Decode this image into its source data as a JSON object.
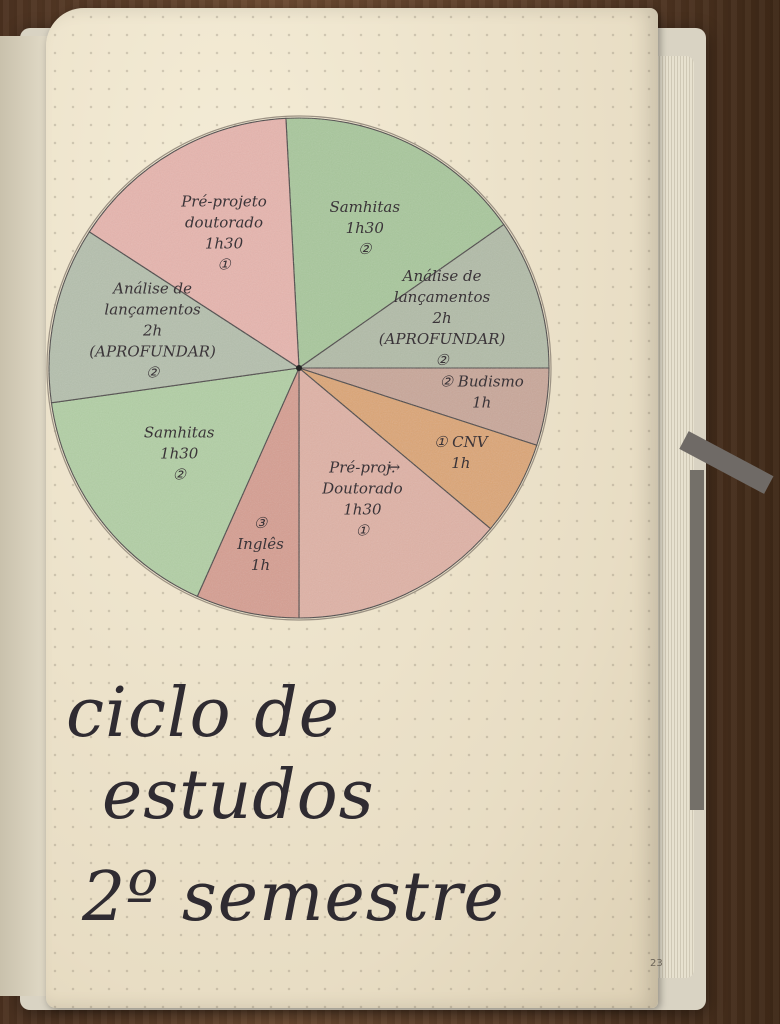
{
  "study_wheel": {
    "slices": [
      {
        "lines": [
          "Samhitas",
          "1h30",
          "②"
        ],
        "color": "#a9c79c",
        "start_deg": -93,
        "end_deg": -35
      },
      {
        "lines": [
          "Análise de",
          "lançamentos",
          "2h",
          "(APROFUNDAR)",
          "②"
        ],
        "color": "#b2bca8",
        "start_deg": -35,
        "end_deg": 0
      },
      {
        "lines": [
          "② Budismo",
          "1h"
        ],
        "color": "#c9a79a",
        "start_deg": 0,
        "end_deg": 18
      },
      {
        "lines": [
          "① CNV",
          "1h"
        ],
        "color": "#dca676",
        "start_deg": 18,
        "end_deg": 40
      },
      {
        "lines": [
          "Pré-proj.",
          "Doutorado",
          "1h30",
          "①"
        ],
        "color": "#dfb2a6",
        "start_deg": 40,
        "end_deg": 90
      },
      {
        "lines": [
          "③",
          "Inglês",
          "1h"
        ],
        "color": "#d69f92",
        "start_deg": 90,
        "end_deg": 114
      },
      {
        "lines": [
          "Samhitas",
          "1h30",
          "②"
        ],
        "color": "#b2cfa5",
        "start_deg": 114,
        "end_deg": 172
      },
      {
        "lines": [
          "Análise de",
          "lançamentos",
          "2h",
          "(APROFUNDAR)",
          "②"
        ],
        "color": "#b5c0ad",
        "start_deg": 172,
        "end_deg": 213
      },
      {
        "lines": [
          "Pré-projeto",
          "doutorado",
          "1h30",
          "①"
        ],
        "color": "#e6b5ae",
        "start_deg": 213,
        "end_deg": 267
      }
    ],
    "swap_arrow": "↔"
  },
  "title": {
    "line1": "ciclo de",
    "line2": "estudos",
    "line3": "2º semestre"
  },
  "page_number": "23",
  "colors": {
    "ink": "#2f2b31",
    "paper": "#efe6cf"
  }
}
